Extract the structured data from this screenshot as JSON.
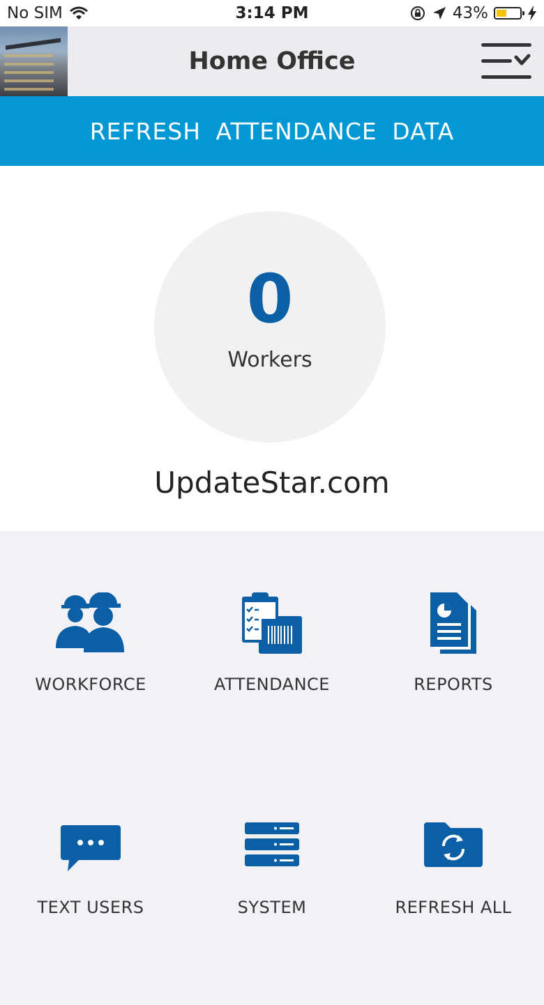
{
  "status_bar": {
    "carrier": "No SIM",
    "time": "3:14 PM",
    "battery_percent": "43%",
    "battery_level": 0.43,
    "icons": [
      "wifi-icon",
      "orientation-lock-icon",
      "location-arrow-icon",
      "battery-icon",
      "charging-bolt-icon"
    ]
  },
  "header": {
    "title": "Home Office",
    "menu_icon": "menu-dropdown-icon"
  },
  "refresh_bar": {
    "label": "REFRESH ATTENDANCE DATA"
  },
  "summary": {
    "count": "0",
    "count_label": "Workers",
    "watermark": "UpdateStar.com"
  },
  "tiles": [
    {
      "label": "WORKFORCE",
      "icon": "workers-hardhat-icon"
    },
    {
      "label": "ATTENDANCE",
      "icon": "clipboard-barcode-icon"
    },
    {
      "label": "REPORTS",
      "icon": "report-document-icon"
    },
    {
      "label": "TEXT USERS",
      "icon": "chat-bubble-icon"
    },
    {
      "label": "SYSTEM",
      "icon": "server-icon"
    },
    {
      "label": "REFRESH ALL",
      "icon": "folder-refresh-icon"
    }
  ],
  "colors": {
    "accent": "#0398d4",
    "icon_blue": "#0b5fa5",
    "header_bg": "#ececf0",
    "tiles_bg": "#f1f1f6"
  }
}
